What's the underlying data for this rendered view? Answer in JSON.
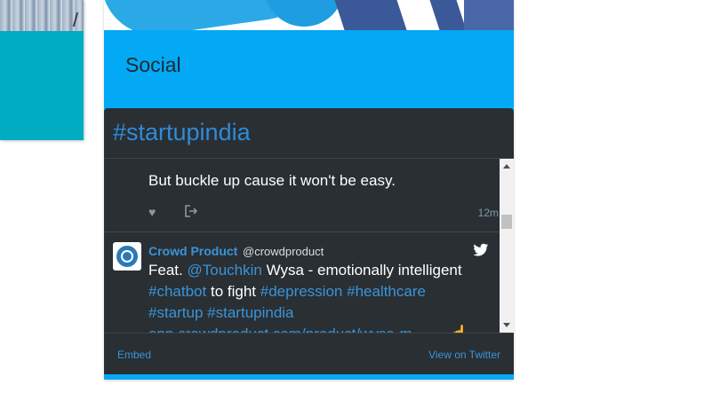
{
  "left_card": {},
  "social_card": {
    "title": "Social"
  },
  "widget": {
    "hashtag": "#startupindia",
    "tweet1": {
      "text": "But buckle up cause it won't be easy.",
      "time": "12m"
    },
    "tweet2": {
      "name": "Crowd Product",
      "handle": "@crowdproduct",
      "text": {
        "w1": "Feat.",
        "l1": "@Touchkin",
        "w2": "Wysa - emotionally intelligent",
        "l2": "#chatbot",
        "w3": "to fight",
        "l3": "#depression",
        "l4": "#healthcare",
        "l5": "#startup",
        "l6": "#startupindia",
        "url": "app.crowdproduct.com/product/wysa-m..."
      }
    },
    "footer": {
      "embed": "Embed",
      "view_on_twitter": "View on Twitter"
    }
  },
  "colors": {
    "social_bg": "#03a9f4",
    "teal": "#00acc1",
    "widget_bg": "#292f33",
    "link": "#3a94d8"
  },
  "icons": [
    "heart-icon",
    "share-icon",
    "twitter-bird-icon",
    "crowd-product-avatar",
    "point-up-emoji"
  ]
}
